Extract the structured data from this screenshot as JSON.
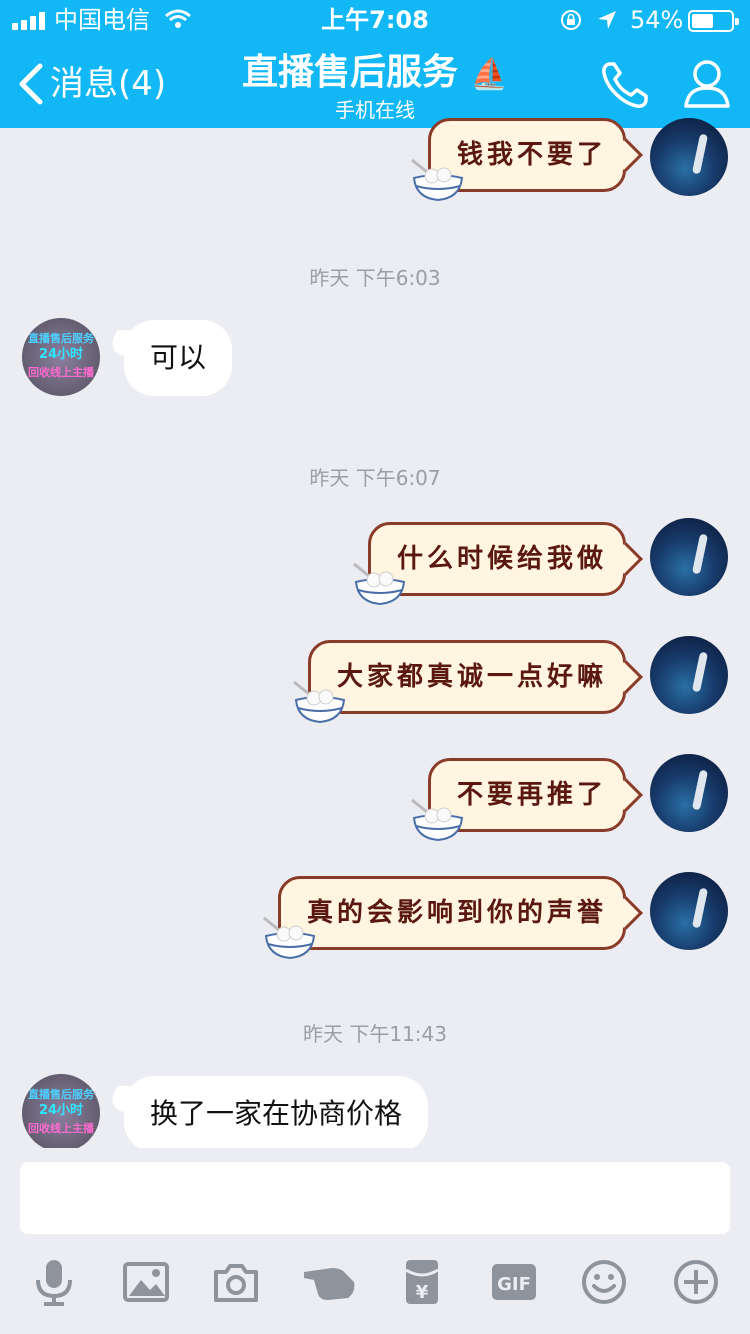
{
  "status_bar": {
    "carrier": "中国电信",
    "time": "上午7:08",
    "battery": "54%",
    "battery_level": 0.54
  },
  "header": {
    "back_label": "消息(4)",
    "title": "直播售后服务",
    "title_emoji": "⛵",
    "subtitle": "手机在线"
  },
  "messages": [
    {
      "kind": "sent",
      "text": "钱我不要了"
    },
    {
      "kind": "timestamp",
      "text": "昨天 下午6:03"
    },
    {
      "kind": "received",
      "text": "可以"
    },
    {
      "kind": "timestamp",
      "text": "昨天 下午6:07"
    },
    {
      "kind": "sent",
      "text": "什么时候给我做"
    },
    {
      "kind": "sent",
      "text": "大家都真诚一点好嘛"
    },
    {
      "kind": "sent",
      "text": "不要再推了"
    },
    {
      "kind": "sent",
      "text": "真的会影响到你的声誉"
    },
    {
      "kind": "timestamp",
      "text": "昨天 下午11:43"
    },
    {
      "kind": "received",
      "text": "换了一家在协商价格"
    }
  ],
  "contact_avatar_text": [
    "直播售后服务",
    "24小时",
    "回收线上主播"
  ],
  "input": {
    "value": ""
  },
  "toolbar": [
    "mic-icon",
    "image-icon",
    "camera-icon",
    "poke-icon",
    "red-packet-icon",
    "gif-icon",
    "emoji-icon",
    "plus-icon"
  ],
  "colors": {
    "header": "#12b7f5",
    "background": "#ebedf2"
  }
}
